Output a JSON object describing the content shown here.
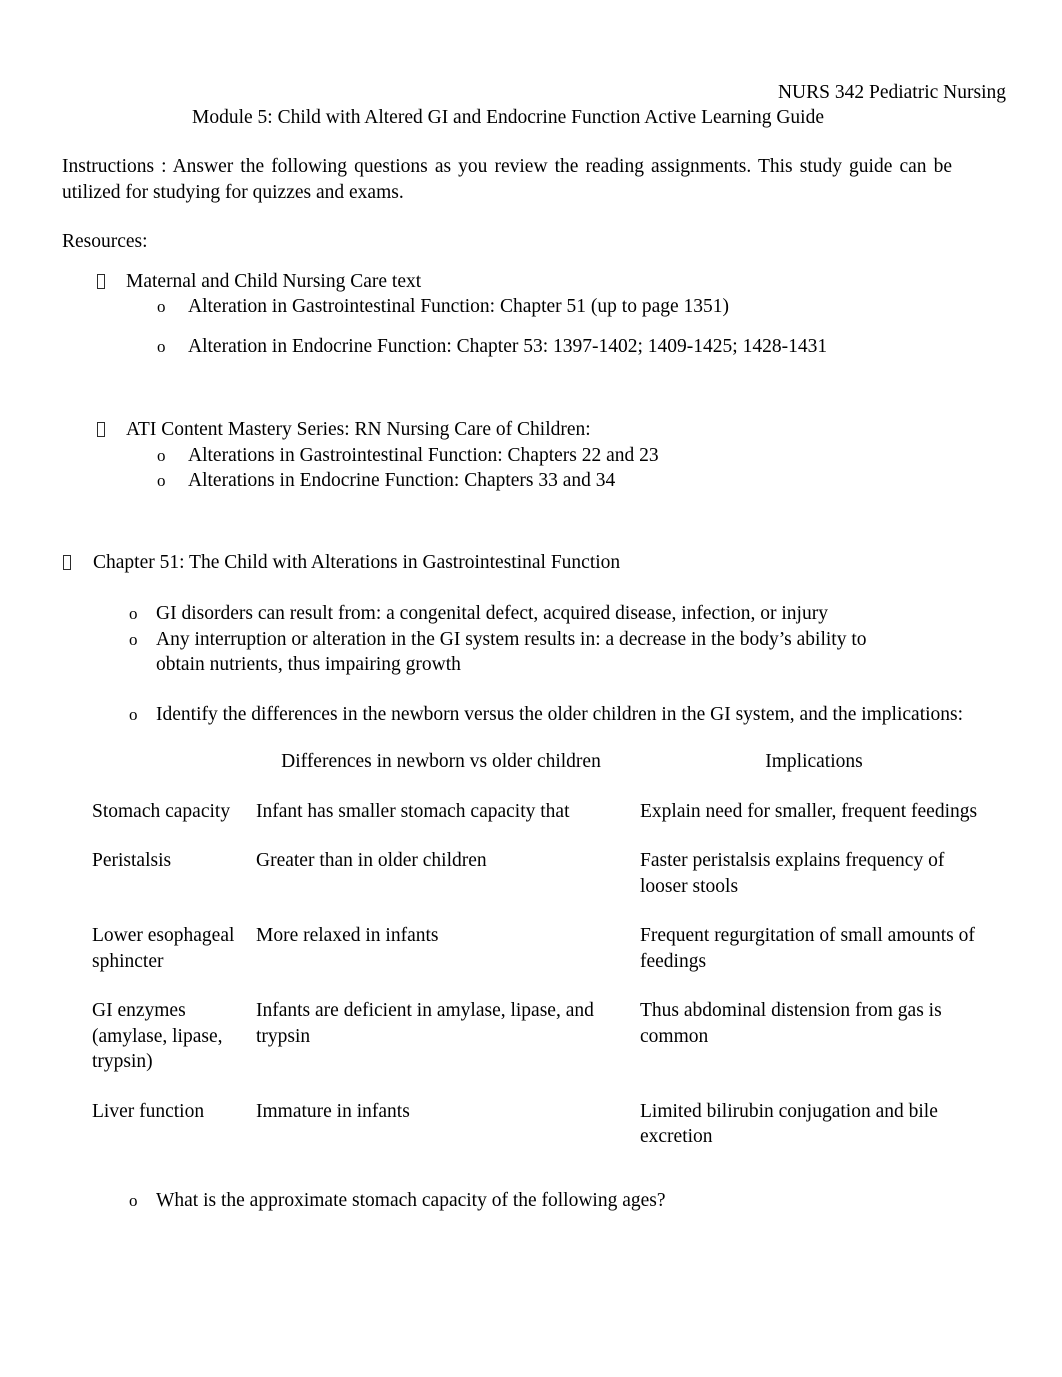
{
  "header": {
    "course": "NURS 342 Pediatric Nursing",
    "module_title": "Module 5:  Child with Altered GI and Endocrine Function Active Learning Guide"
  },
  "instructions": {
    "text": "Instructions :  Answer the following questions as you review the reading assignments.   This study guide can be utilized for studying for quizzes and exams."
  },
  "resources": {
    "heading": "Resources:",
    "items": [
      {
        "label": "Maternal and Child Nursing Care text",
        "sub": [
          "Alteration in Gastrointestinal Function:    Chapter 51 (up to page 1351)",
          "Alteration in Endocrine Function:   Chapter 53: 1397-1402; 1409-1425; 1428-1431"
        ]
      },
      {
        "label": "ATI Content Mastery Series:  RN Nursing Care of Children:",
        "sub": [
          "Alterations in Gastrointestinal Function:    Chapters 22 and 23",
          "Alterations in Endocrine Function:  Chapters 33 and 34"
        ]
      }
    ]
  },
  "chapter51": {
    "title": "Chapter 51: The Child with Alterations in Gastrointestinal Function",
    "points": [
      "GI disorders can result from:  a congenital defect, acquired disease, infection, or injury",
      "Any interruption or alteration in the GI system results in:     a decrease in the body’s ability to obtain nutrients, thus impairing growth"
    ],
    "table_prompt": "Identify the differences in the newborn versus the older children in the GI system, and the implications:",
    "closing_prompt": "What is the approximate stomach capacity of the following ages?"
  },
  "compare_table": {
    "headers": [
      "",
      "Differences in newborn vs older children",
      "Implications"
    ],
    "rows": [
      {
        "feature": "Stomach capacity",
        "difference": "Infant has smaller stomach capacity that",
        "implication": "Explain need for smaller, frequent feedings"
      },
      {
        "feature": "Peristalsis",
        "difference": "Greater than in older children",
        "implication": "Faster peristalsis explains frequency of looser stools"
      },
      {
        "feature": "Lower esophageal sphincter",
        "difference": "More relaxed in infants",
        "implication": "Frequent regurgitation of small amounts of feedings"
      },
      {
        "feature": "GI enzymes (amylase, lipase, trypsin)",
        "difference": "Infants are deficient in amylase, lipase, and trypsin",
        "implication": "Thus abdominal distension from gas is common"
      },
      {
        "feature": "Liver function",
        "difference": "Immature in infants",
        "implication": "Limited bilirubin conjugation and bile excretion"
      }
    ]
  },
  "markers": {
    "sub_bullet": "o"
  }
}
